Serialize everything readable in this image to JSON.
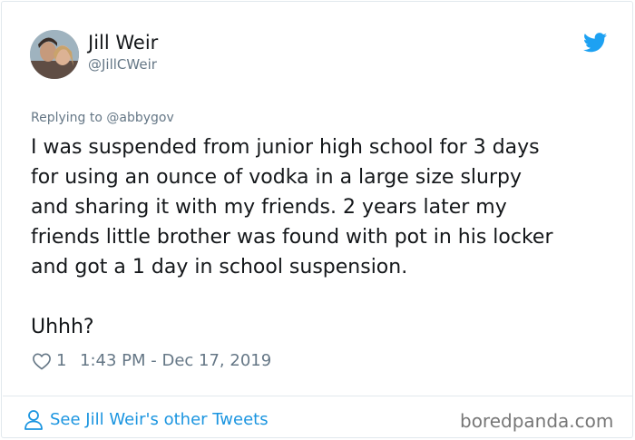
{
  "author": {
    "display_name": "Jill Weir",
    "handle": "@JillCWeir",
    "avatar_icon": "profile-photo"
  },
  "brand": {
    "logo_icon": "twitter-bird-icon",
    "accent_color": "#1da1f2"
  },
  "tweet": {
    "replying_to": "Replying to @abbygov",
    "lines": [
      "I was suspended from junior high school for 3 days",
      "for using an ounce of vodka in a large size slurpy",
      "and sharing it with my friends. 2 years later my",
      "friends little brother was found with pot in his locker",
      "and got a 1 day in school suspension."
    ],
    "closing": "Uhhh?"
  },
  "meta": {
    "like_icon": "heart-icon",
    "like_count": "1",
    "timestamp": "1:43 PM - Dec 17, 2019"
  },
  "footer": {
    "see_other_icon": "person-icon",
    "see_other_label": "See Jill Weir's other Tweets",
    "link_color": "#1b95e0",
    "watermark": "boredpanda.com"
  }
}
